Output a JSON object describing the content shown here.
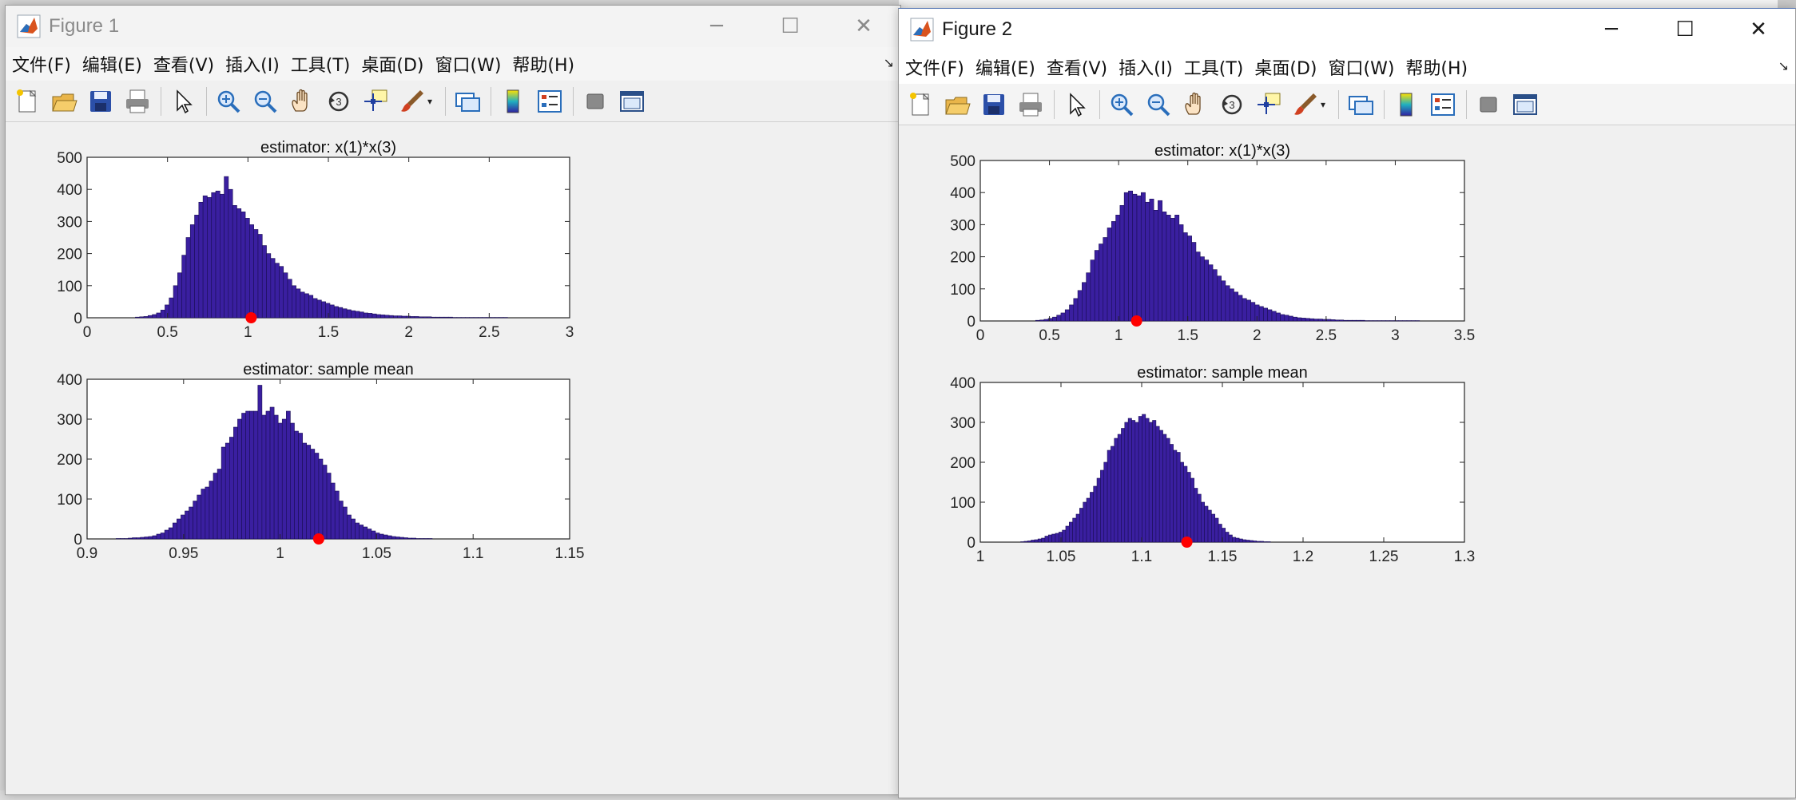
{
  "windows": [
    {
      "title": "Figure 1",
      "menu": [
        "文件(F)",
        "编辑(E)",
        "查看(V)",
        "插入(I)",
        "工具(T)",
        "桌面(D)",
        "窗口(W)",
        "帮助(H)"
      ],
      "toolbar_icons": [
        "new-figure-icon",
        "open-file-icon",
        "save-icon",
        "print-icon",
        "select-arrow-icon",
        "zoom-in-icon",
        "zoom-out-icon",
        "pan-hand-icon",
        "rotate-3d-icon",
        "data-cursor-icon",
        "brush-icon",
        "link-plot-icon",
        "colorbar-icon",
        "legend-icon",
        "hide-plot-tools-icon",
        "show-plot-tools-icon"
      ]
    },
    {
      "title": "Figure 2",
      "menu": [
        "文件(F)",
        "编辑(E)",
        "查看(V)",
        "插入(I)",
        "工具(T)",
        "桌面(D)",
        "窗口(W)",
        "帮助(H)"
      ],
      "toolbar_icons": [
        "new-figure-icon",
        "open-file-icon",
        "save-icon",
        "print-icon",
        "select-arrow-icon",
        "zoom-in-icon",
        "zoom-out-icon",
        "pan-hand-icon",
        "rotate-3d-icon",
        "data-cursor-icon",
        "brush-icon",
        "link-plot-icon",
        "colorbar-icon",
        "legend-icon",
        "hide-plot-tools-icon",
        "show-plot-tools-icon"
      ]
    }
  ],
  "colors": {
    "bar_fill": "#3a1fa0",
    "bar_edge": "#1a0e55",
    "marker": "#ff0000",
    "axes_bg": "#ffffff",
    "figure_bg": "#f0f0f0"
  },
  "chart_data": [
    {
      "figure": "Figure 1",
      "type": "bar",
      "title": "estimator: x(1)*x(3)",
      "xlim": [
        0,
        3
      ],
      "ylim": [
        0,
        500
      ],
      "xticks": [
        "0",
        "0.5",
        "1",
        "1.5",
        "2",
        "2.5",
        "3"
      ],
      "yticks": [
        "0",
        "100",
        "200",
        "300",
        "400",
        "500"
      ],
      "bin_start": 0.3,
      "bin_width": 0.0263,
      "values": [
        2,
        3,
        4,
        7,
        10,
        15,
        24,
        40,
        62,
        100,
        140,
        195,
        250,
        290,
        320,
        360,
        380,
        375,
        390,
        395,
        385,
        440,
        400,
        350,
        340,
        330,
        310,
        290,
        275,
        260,
        225,
        200,
        185,
        170,
        160,
        140,
        120,
        100,
        90,
        80,
        75,
        70,
        60,
        55,
        50,
        45,
        40,
        35,
        32,
        28,
        25,
        22,
        20,
        18,
        15,
        14,
        12,
        10,
        9,
        8,
        7,
        6,
        6,
        5,
        5,
        4,
        4,
        3,
        3,
        3,
        2,
        2,
        2,
        2,
        2,
        1,
        1,
        1,
        1,
        1,
        1,
        1,
        1,
        1,
        1,
        1,
        1,
        1,
        0,
        0
      ],
      "marker_x": 1.02
    },
    {
      "figure": "Figure 1",
      "type": "bar",
      "title": "estimator: sample mean",
      "xlim": [
        0.9,
        1.15
      ],
      "ylim": [
        0,
        400
      ],
      "xticks": [
        "0.9",
        "0.95",
        "1",
        "1.05",
        "1.1",
        "1.15"
      ],
      "yticks": [
        "0",
        "100",
        "200",
        "300",
        "400"
      ],
      "bin_start": 0.915,
      "bin_width": 0.0021,
      "values": [
        1,
        1,
        1,
        2,
        3,
        3,
        4,
        5,
        6,
        8,
        12,
        15,
        22,
        28,
        40,
        50,
        60,
        70,
        80,
        95,
        110,
        125,
        130,
        145,
        165,
        175,
        230,
        240,
        255,
        280,
        300,
        315,
        320,
        320,
        320,
        385,
        310,
        320,
        330,
        310,
        290,
        300,
        320,
        290,
        270,
        265,
        240,
        235,
        225,
        215,
        200,
        185,
        165,
        140,
        120,
        95,
        80,
        60,
        50,
        40,
        35,
        30,
        25,
        20,
        15,
        12,
        10,
        8,
        6,
        5,
        4,
        3,
        2,
        2,
        1,
        1,
        1,
        1
      ],
      "marker_x": 1.02
    },
    {
      "figure": "Figure 2",
      "type": "bar",
      "title": "estimator: x(1)*x(3)",
      "xlim": [
        0,
        3.5
      ],
      "ylim": [
        0,
        500
      ],
      "xticks": [
        "0",
        "0.5",
        "1",
        "1.5",
        "2",
        "2.5",
        "3",
        "3.5"
      ],
      "yticks": [
        "0",
        "100",
        "200",
        "300",
        "400",
        "500"
      ],
      "bin_start": 0.4,
      "bin_width": 0.0305,
      "values": [
        2,
        3,
        5,
        8,
        12,
        18,
        25,
        35,
        50,
        70,
        95,
        120,
        150,
        190,
        220,
        240,
        260,
        290,
        310,
        330,
        360,
        400,
        405,
        395,
        390,
        400,
        370,
        380,
        345,
        375,
        340,
        330,
        320,
        330,
        300,
        275,
        265,
        245,
        215,
        200,
        190,
        175,
        160,
        140,
        125,
        110,
        100,
        90,
        80,
        70,
        65,
        58,
        50,
        45,
        40,
        35,
        30,
        25,
        20,
        18,
        15,
        12,
        10,
        9,
        8,
        7,
        6,
        6,
        5,
        5,
        4,
        3,
        3,
        2,
        2,
        2,
        2,
        2,
        1,
        1,
        1,
        1,
        1,
        1,
        1,
        1,
        1,
        1,
        1,
        1,
        1,
        0,
        0,
        0,
        0,
        0
      ],
      "marker_x": 1.13
    },
    {
      "figure": "Figure 2",
      "type": "bar",
      "title": "estimator: sample mean",
      "xlim": [
        1,
        1.3
      ],
      "ylim": [
        0,
        400
      ],
      "xticks": [
        "1",
        "1.05",
        "1.1",
        "1.15",
        "1.2",
        "1.25",
        "1.3"
      ],
      "yticks": [
        "0",
        "100",
        "200",
        "300",
        "400"
      ],
      "bin_start": 1.025,
      "bin_width": 0.00215,
      "values": [
        1,
        2,
        3,
        5,
        6,
        8,
        10,
        15,
        18,
        20,
        22,
        25,
        30,
        40,
        50,
        60,
        70,
        85,
        100,
        110,
        125,
        140,
        160,
        180,
        200,
        230,
        240,
        260,
        270,
        285,
        300,
        310,
        305,
        300,
        315,
        320,
        310,
        300,
        305,
        290,
        280,
        270,
        260,
        245,
        230,
        225,
        200,
        190,
        175,
        160,
        135,
        120,
        100,
        90,
        80,
        70,
        60,
        45,
        35,
        25,
        18,
        12,
        10,
        8,
        6,
        5,
        4,
        3,
        2,
        2,
        1,
        1
      ],
      "marker_x": 1.128
    }
  ]
}
